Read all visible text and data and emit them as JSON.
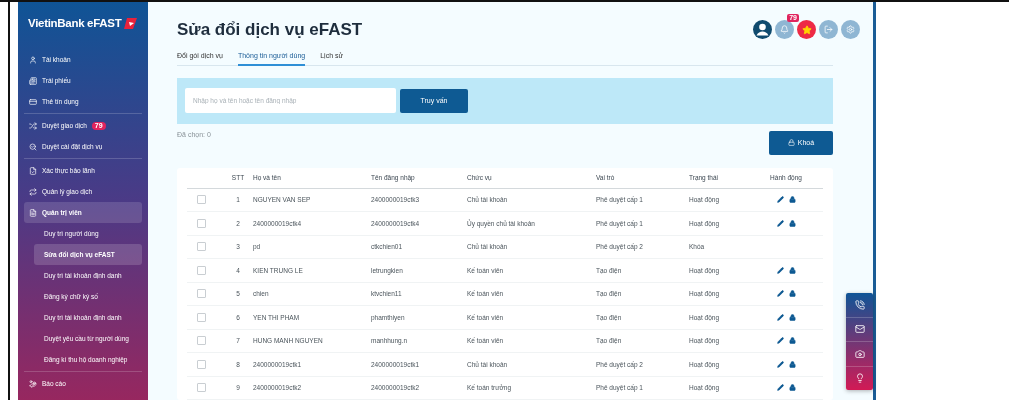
{
  "sidebar": {
    "logo": {
      "text": "VietinBank eFAST"
    },
    "sections": [
      {
        "items": [
          {
            "label": "Tài khoản",
            "selected": false
          },
          {
            "label": "Trái phiếu",
            "selected": false
          },
          {
            "label": "Thẻ tín dụng",
            "selected": false
          }
        ]
      },
      {
        "items": [
          {
            "label": "Duyệt giao dịch",
            "selected": false,
            "badge": "79"
          },
          {
            "label": "Duyệt cài đặt dịch vụ",
            "selected": false
          }
        ]
      },
      {
        "items": [
          {
            "label": "Xác thực bảo lãnh",
            "selected": false
          },
          {
            "label": "Quản lý giao dịch",
            "selected": false
          },
          {
            "label": "Quản trị viên",
            "selected": true,
            "children": [
              {
                "label": "Duy trì người dùng",
                "selected": false
              },
              {
                "label": "Sửa đổi dịch vụ eFAST",
                "selected": true
              },
              {
                "label": "Duy trì tài khoản định danh",
                "selected": false
              },
              {
                "label": "Đăng ký chữ ký số",
                "selected": false
              },
              {
                "label": "Duy trì tài khoản định danh",
                "selected": false
              },
              {
                "label": "Duyệt yêu cầu từ người dùng",
                "selected": false
              },
              {
                "label": "Đăng kí thu hộ doanh nghiệp",
                "selected": false
              }
            ]
          }
        ]
      },
      {
        "items": [
          {
            "label": "Báo cáo",
            "selected": false
          }
        ]
      }
    ]
  },
  "header": {
    "title": "Sửa đổi dịch vụ eFAST",
    "notification_badge": "79"
  },
  "tabs": [
    {
      "label": "Đổi gói dịch vụ",
      "selected": false
    },
    {
      "label": "Thông tin người dùng",
      "selected": true
    },
    {
      "label": "Lịch sử",
      "selected": false
    }
  ],
  "search": {
    "placeholder": "Nhập họ và tên hoặc tên đăng nhập",
    "button": "Truy vấn"
  },
  "selected_count": "Đã chọn: 0",
  "lock_button": "Khoá",
  "table": {
    "columns": [
      "STT",
      "Họ và tên",
      "Tên đăng nhập",
      "Chức vụ",
      "Vai trò",
      "Trạng thái",
      "Hành động"
    ],
    "rows": [
      {
        "checked": false,
        "stt": "1",
        "name": "NGUYEN VAN SEP",
        "username": "2400000019ctk3",
        "position": "Chủ tài khoản",
        "role": "Phê duyệt cấp 1",
        "status": "Hoạt động",
        "actions": true
      },
      {
        "checked": false,
        "stt": "2",
        "name": "2400000019ctk4",
        "username": "2400000019ctk4",
        "position": "Ủy quyền chủ tài khoản",
        "role": "Phê duyệt cấp 1",
        "status": "Hoạt động",
        "actions": true
      },
      {
        "checked": false,
        "stt": "3",
        "name": "pd",
        "username": "ctkchien01",
        "position": "Chủ tài khoản",
        "role": "Phê duyệt cấp 2",
        "status": "Khóa",
        "actions": false
      },
      {
        "checked": false,
        "stt": "4",
        "name": "KIEN TRUNG LE",
        "username": "letrungkien",
        "position": "Kế toán viên",
        "role": "Tạo điện",
        "status": "Hoạt động",
        "actions": true
      },
      {
        "checked": false,
        "stt": "5",
        "name": "chien",
        "username": "ktvchien11",
        "position": "Kế toán viên",
        "role": "Tạo điện",
        "status": "Hoạt động",
        "actions": true
      },
      {
        "checked": false,
        "stt": "6",
        "name": "YEN THI PHAM",
        "username": "phamthiyen",
        "position": "Kế toán viên",
        "role": "Tạo điện",
        "status": "Hoạt động",
        "actions": true
      },
      {
        "checked": false,
        "stt": "7",
        "name": "HUNG MANH NGUYEN",
        "username": "manhhung.n",
        "position": "Kế toán viên",
        "role": "Tạo điện",
        "status": "Hoạt động",
        "actions": true
      },
      {
        "checked": false,
        "stt": "8",
        "name": "2400000019ctk1",
        "username": "2400000019ctk1",
        "position": "Chủ tài khoản",
        "role": "Phê duyệt cấp 2",
        "status": "Hoạt động",
        "actions": true
      },
      {
        "checked": false,
        "stt": "9",
        "name": "2400000019ctk2",
        "username": "2400000019ctk2",
        "position": "Kế toán trưởng",
        "role": "Phê duyệt cấp 1",
        "status": "Hoạt động",
        "actions": true
      }
    ]
  }
}
